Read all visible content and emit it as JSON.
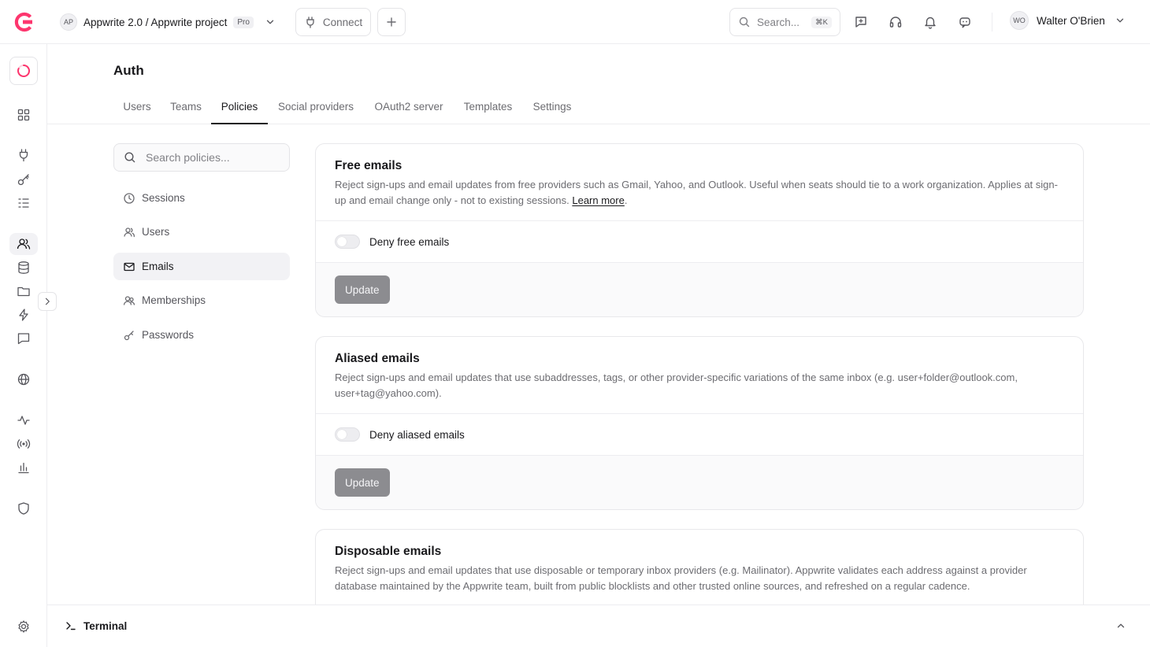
{
  "header": {
    "project_initials": "AP",
    "project_name": "Appwrite 2.0 / Appwrite project",
    "plan_badge": "Pro",
    "connect_label": "Connect",
    "search_placeholder": "Search...",
    "search_shortcut": "⌘K",
    "user_initials": "WO",
    "user_name": "Walter O'Brien"
  },
  "page": {
    "title": "Auth",
    "tabs": [
      {
        "label": "Users"
      },
      {
        "label": "Teams"
      },
      {
        "label": "Policies"
      },
      {
        "label": "Social providers"
      },
      {
        "label": "OAuth2 server"
      },
      {
        "label": "Templates"
      },
      {
        "label": "Settings"
      }
    ],
    "active_tab": "Policies"
  },
  "policies_nav": {
    "search_placeholder": "Search policies...",
    "items": [
      {
        "label": "Sessions",
        "icon": "clock-icon"
      },
      {
        "label": "Users",
        "icon": "users-icon"
      },
      {
        "label": "Emails",
        "icon": "mail-icon"
      },
      {
        "label": "Memberships",
        "icon": "memberships-icon"
      },
      {
        "label": "Passwords",
        "icon": "key-icon"
      }
    ],
    "active_item": "Emails"
  },
  "cards": [
    {
      "title": "Free emails",
      "description": "Reject sign-ups and email updates from free providers such as Gmail, Yahoo, and Outlook. Useful when seats should tie to a work organization. Applies at sign-up and email change only - not to existing sessions.",
      "link": "Learn more",
      "toggle_label": "Deny free emails",
      "toggle_on": false,
      "button": "Update"
    },
    {
      "title": "Aliased emails",
      "description": "Reject sign-ups and email updates that use subaddresses, tags, or other provider-specific variations of the same inbox (e.g. user+folder@outlook.com, user+tag@yahoo.com).",
      "toggle_label": "Deny aliased emails",
      "toggle_on": false,
      "button": "Update"
    },
    {
      "title": "Disposable emails",
      "description": "Reject sign-ups and email updates that use disposable or temporary inbox providers (e.g. Mailinator). Appwrite validates each address against a provider database maintained by the Appwrite team, built from public blocklists and other trusted online sources, and refreshed on a regular cadence."
    }
  ],
  "terminal": {
    "label": "Terminal"
  },
  "colors": {
    "brand": "#fd366e",
    "text": "#19191c",
    "muted": "#6c6c71",
    "border": "#ededf0",
    "button_disabled": "#8c8c90"
  }
}
